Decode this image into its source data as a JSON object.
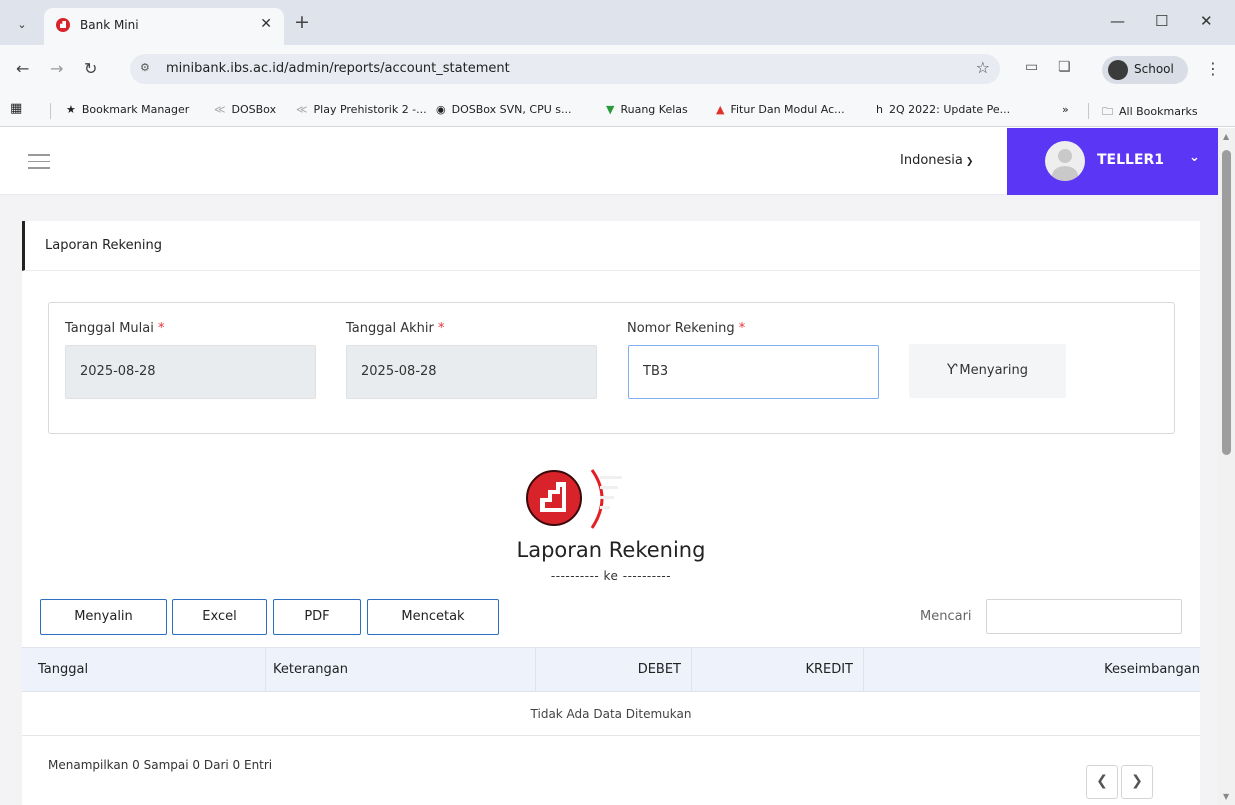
{
  "browser": {
    "tab_title": "Bank Mini",
    "url": "minibank.ibs.ac.id/admin/reports/account_statement",
    "profile_label": "School",
    "bookmarks": [
      "Bookmark Manager",
      "DOSBox",
      "Play Prehistorik 2 -...",
      "DOSBox SVN, CPU s...",
      "Ruang Kelas",
      "Fitur Dan Modul Ac...",
      "2Q 2022: Update Pe..."
    ],
    "bookmarks_overflow": "»",
    "all_bookmarks": "All Bookmarks"
  },
  "header": {
    "language": "Indonesia",
    "user_name": "TELLER1"
  },
  "card": {
    "title": "Laporan Rekening"
  },
  "filter": {
    "start_label": "Tanggal Mulai",
    "start_value": "2025-08-28",
    "end_label": "Tanggal Akhir",
    "end_value": "2025-08-28",
    "account_label": "Nomor Rekening",
    "account_value": "TB3",
    "required_mark": "*",
    "filter_button": "Menyaring"
  },
  "report": {
    "title": "Laporan Rekening",
    "subtitle": "---------- ke ----------"
  },
  "buttons": {
    "copy": "Menyalin",
    "excel": "Excel",
    "pdf": "PDF",
    "print": "Mencetak"
  },
  "search": {
    "label": "Mencari"
  },
  "table": {
    "columns": [
      "Tanggal",
      "Keterangan",
      "DEBET",
      "KREDIT",
      "Keseimbangan"
    ],
    "empty_message": "Tidak Ada Data Ditemukan"
  },
  "pagination": {
    "info": "Menampilkan 0 Sampai 0 Dari 0 Entri"
  },
  "colors": {
    "accent": "#5b36f5",
    "logo_red": "#d8232a",
    "table_header_bg": "#edf2fb"
  }
}
